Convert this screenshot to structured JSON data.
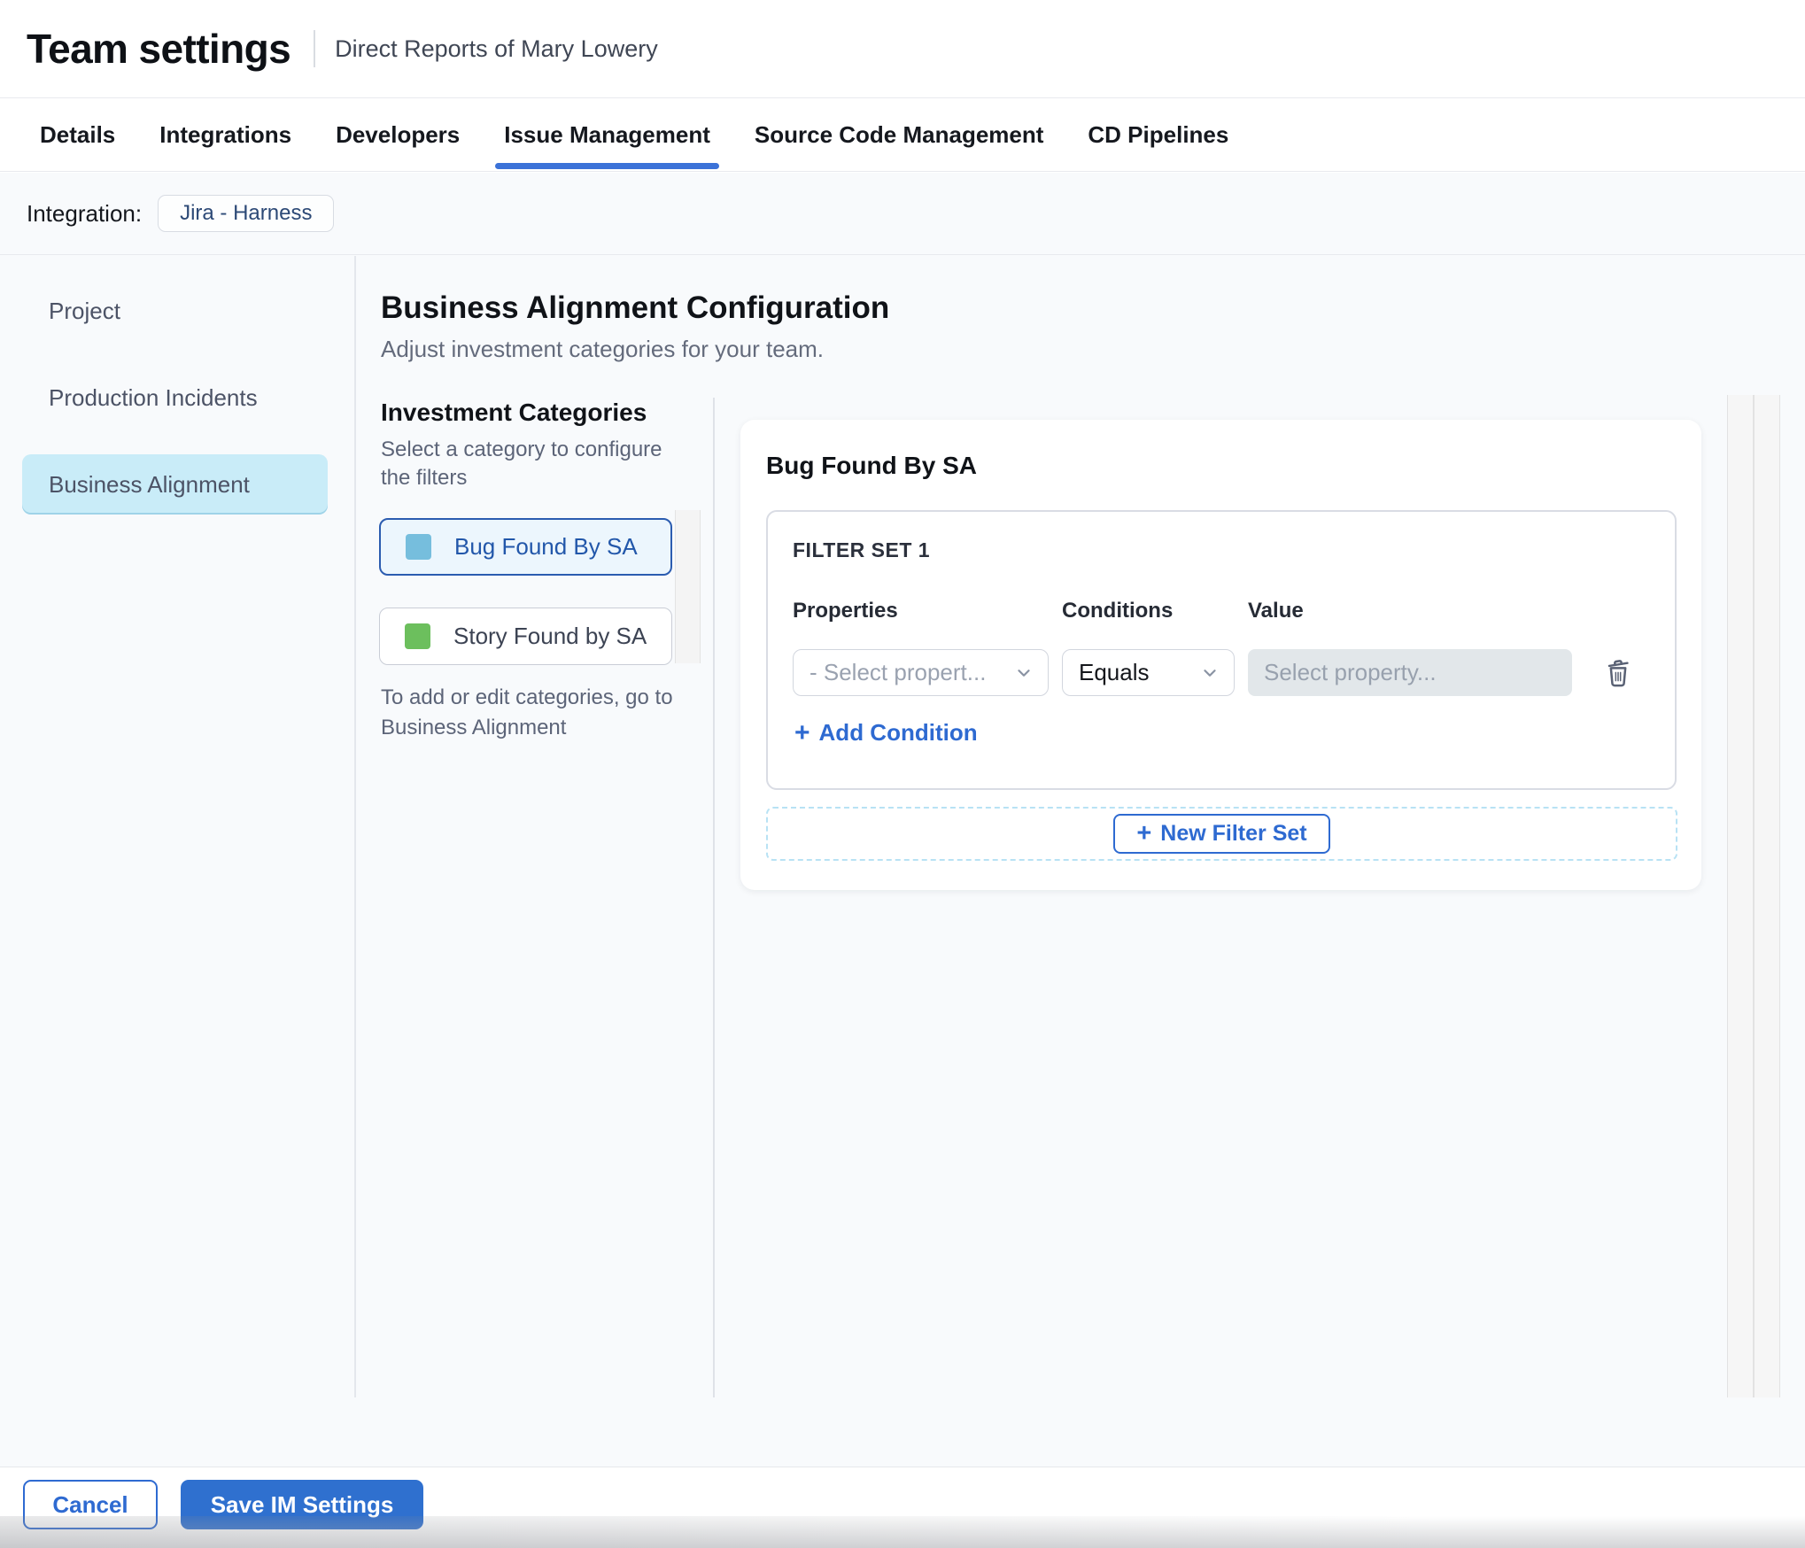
{
  "header": {
    "title": "Team settings",
    "subtitle": "Direct Reports of Mary Lowery"
  },
  "tabs": [
    {
      "label": "Details",
      "active": false
    },
    {
      "label": "Integrations",
      "active": false
    },
    {
      "label": "Developers",
      "active": false
    },
    {
      "label": "Issue Management",
      "active": true
    },
    {
      "label": "Source Code Management",
      "active": false
    },
    {
      "label": "CD Pipelines",
      "active": false
    }
  ],
  "integration": {
    "label": "Integration:",
    "chip": "Jira - Harness"
  },
  "sidebar": {
    "items": [
      {
        "label": "Project",
        "selected": false
      },
      {
        "label": "Production Incidents",
        "selected": false
      },
      {
        "label": "Business Alignment",
        "selected": true
      }
    ]
  },
  "main": {
    "title": "Business Alignment Configuration",
    "subtitle": "Adjust investment categories for your team.",
    "categories": {
      "heading": "Investment Categories",
      "hint": "Select a category to configure the filters",
      "items": [
        {
          "label": "Bug Found By SA",
          "color": "#76bedd",
          "selected": true
        },
        {
          "label": "Story Found by SA",
          "color": "#6cbf5d",
          "selected": false
        }
      ],
      "note": "To add or edit categories, go to Business Alignment"
    },
    "panel": {
      "title": "Bug Found By SA",
      "filter_set": {
        "heading": "FILTER SET 1",
        "columns": [
          "Properties",
          "Conditions",
          "Value"
        ],
        "property_placeholder": "- Select propert...",
        "condition_value": "Equals",
        "value_placeholder": "Select property...",
        "add_condition_label": "Add Condition"
      },
      "new_filter_set_label": "New Filter Set"
    }
  },
  "footer": {
    "cancel_label": "Cancel",
    "save_label": "Save IM Settings"
  },
  "icons": {
    "plus": "+",
    "select_caret": "chevron-down",
    "delete_condition": "trash",
    "category_swatch": "color-square"
  },
  "colors": {
    "accent_blue": "#2e6ad1",
    "tab_underline": "#3b72d8",
    "save_button_bg": "#2f70cf",
    "selected_sidebar_bg": "#c9ecf8",
    "selected_category_bg": "#ecf6fd",
    "selected_category_border": "#2b5cb0",
    "bug_swatch": "#76bedd",
    "story_swatch": "#6cbf5d",
    "page_bg": "#f8fafc"
  }
}
